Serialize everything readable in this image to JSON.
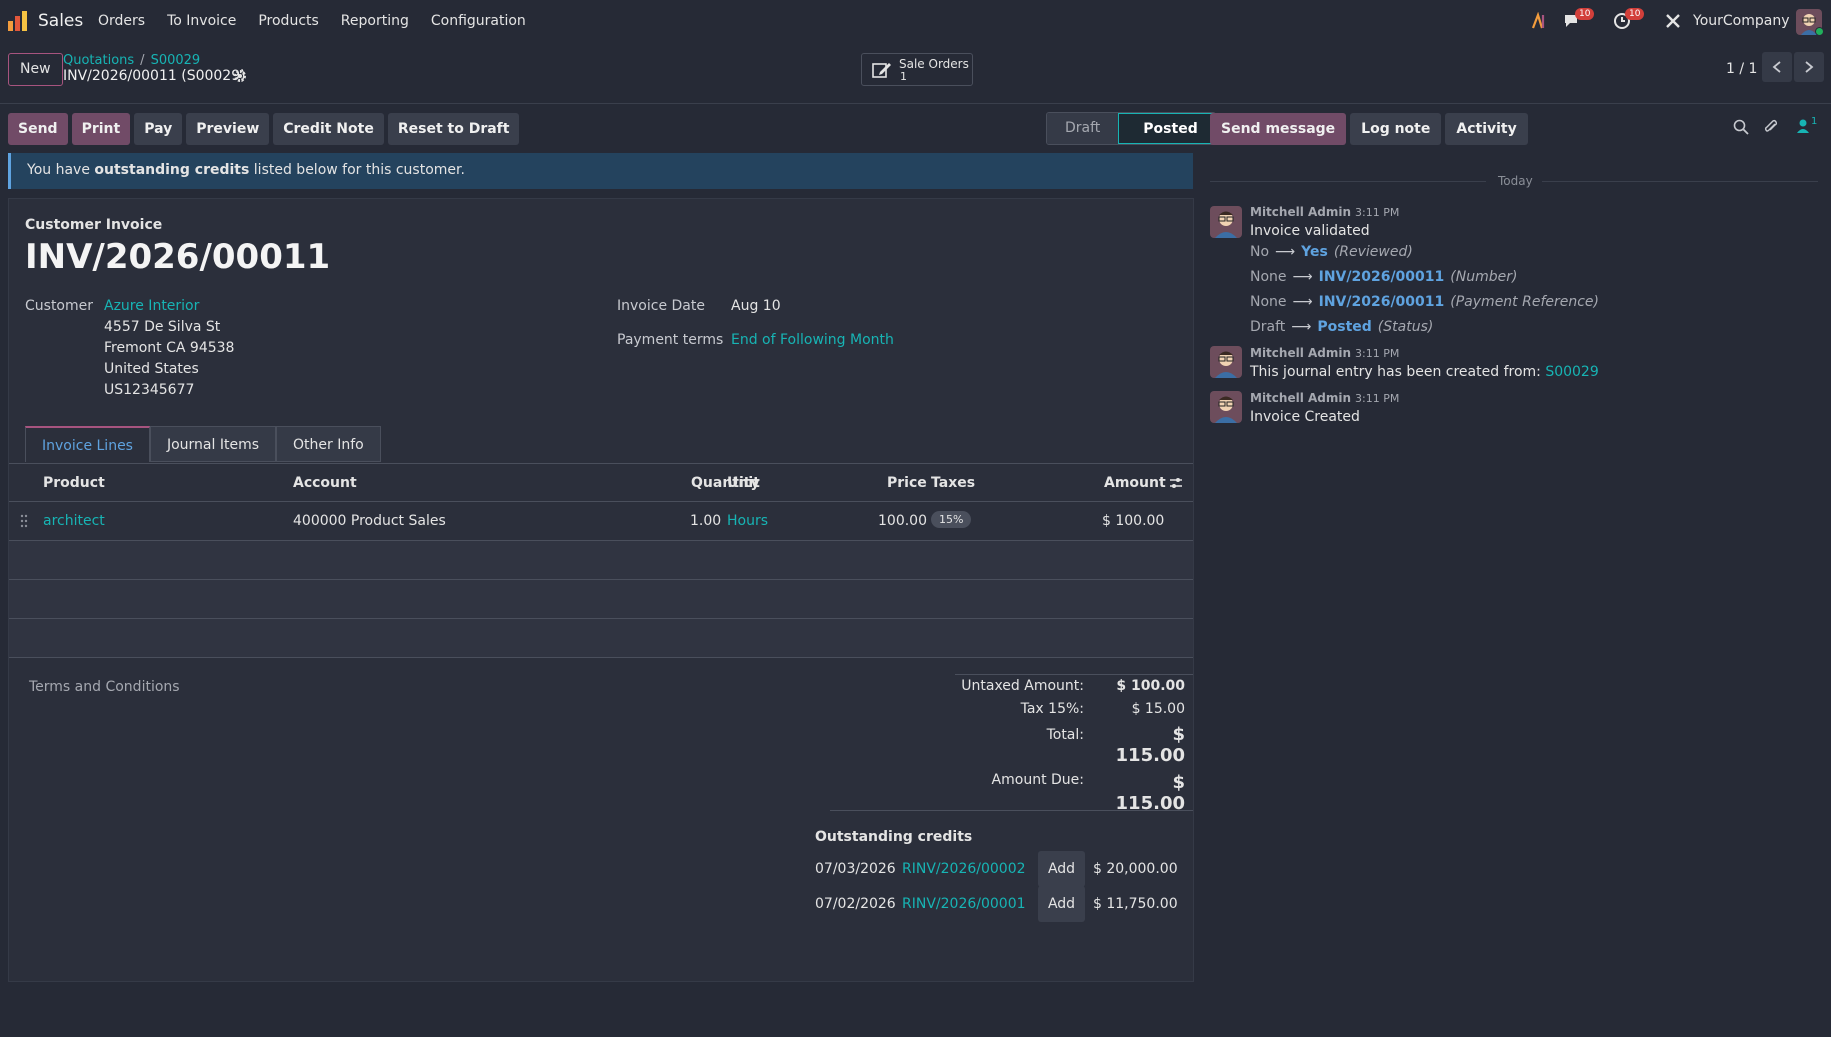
{
  "app": {
    "name": "Sales"
  },
  "menu": [
    "Orders",
    "To Invoice",
    "Products",
    "Reporting",
    "Configuration"
  ],
  "topbar": {
    "messages_count": "10",
    "activities_count": "10",
    "company": "YourCompany"
  },
  "control": {
    "new_label": "New",
    "breadcrumb": [
      "Quotations",
      "S00029"
    ],
    "record_name": "INV/2026/00011 (S00029)",
    "smart_button": {
      "label": "Sale Orders",
      "count": "1"
    },
    "pager": "1 / 1"
  },
  "actions": [
    "Send",
    "Print",
    "Pay",
    "Preview",
    "Credit Note",
    "Reset to Draft"
  ],
  "status": {
    "steps": [
      "Draft",
      "Posted"
    ],
    "current": "Posted"
  },
  "alert": {
    "pre": "You have ",
    "bold": "outstanding credits",
    "post": " listed below for this customer."
  },
  "invoice": {
    "type": "Customer Invoice",
    "name": "INV/2026/00011",
    "customer_label": "Customer",
    "customer": "Azure Interior",
    "address": [
      "4557 De Silva St",
      "Fremont CA 94538",
      "United States",
      "US12345677"
    ],
    "date_label": "Invoice Date",
    "date": "Aug 10",
    "terms_label": "Payment terms",
    "terms": "End of Following Month"
  },
  "tabs": [
    "Invoice Lines",
    "Journal Items",
    "Other Info"
  ],
  "lines": {
    "headers": {
      "product": "Product",
      "account": "Account",
      "quantity": "Quantity",
      "unit": "Unit",
      "price": "Price",
      "taxes": "Taxes",
      "amount": "Amount"
    },
    "rows": [
      {
        "product": "architect",
        "account": "400000 Product Sales",
        "quantity": "1.00",
        "unit": "Hours",
        "price": "100.00",
        "tax": "15%",
        "amount": "$ 100.00"
      }
    ]
  },
  "terms_placeholder": "Terms and Conditions",
  "totals": {
    "untaxed_label": "Untaxed Amount:",
    "untaxed": "$ 100.00",
    "tax_label": "Tax 15%:",
    "tax": "$ 15.00",
    "total_label": "Total:",
    "total": "$ 115.00",
    "due_label": "Amount Due:",
    "due": "$ 115.00"
  },
  "outstanding": {
    "title": "Outstanding credits",
    "add_label": "Add",
    "items": [
      {
        "date": "07/03/2026",
        "ref": "RINV/2026/00002",
        "amount": "$ 20,000.00"
      },
      {
        "date": "07/02/2026",
        "ref": "RINV/2026/00001",
        "amount": "$ 11,750.00"
      }
    ]
  },
  "chatter": {
    "buttons": [
      "Send message",
      "Log note",
      "Activity"
    ],
    "followers": "1",
    "today": "Today",
    "messages": [
      {
        "author": "Mitchell Admin",
        "time": "3:11 PM",
        "body": "Invoice validated",
        "tracking": [
          {
            "old": "No",
            "new": "Yes",
            "field": "(Reviewed)"
          },
          {
            "old": "None",
            "new": "INV/2026/00011",
            "field": "(Number)"
          },
          {
            "old": "None",
            "new": "INV/2026/00011",
            "field": "(Payment Reference)"
          },
          {
            "old": "Draft",
            "new": "Posted",
            "field": "(Status)"
          }
        ]
      },
      {
        "author": "Mitchell Admin",
        "time": "3:11 PM",
        "body": "This journal entry has been created from: ",
        "link": "S00029"
      },
      {
        "author": "Mitchell Admin",
        "time": "3:11 PM",
        "body": "Invoice Created"
      }
    ]
  },
  "colors": {
    "brand": "#714b67",
    "accent": "#17b4b4",
    "link_blue": "#5fa3e0",
    "badge_red": "#d23f3a"
  }
}
